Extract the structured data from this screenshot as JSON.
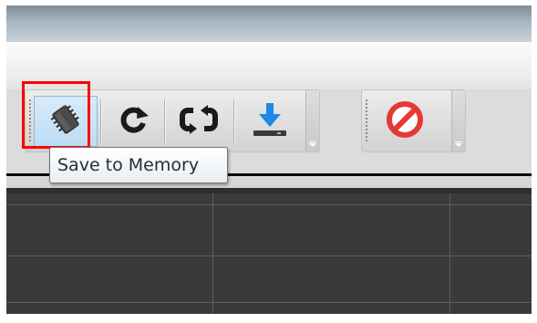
{
  "toolbar": {
    "buttons": [
      {
        "name": "save-to-memory",
        "icon": "memory-chip-icon"
      },
      {
        "name": "refresh",
        "icon": "refresh-icon"
      },
      {
        "name": "sync",
        "icon": "sync-icon"
      },
      {
        "name": "download",
        "icon": "download-icon"
      }
    ],
    "stop_button": {
      "icon": "stop-icon"
    }
  },
  "tooltip": {
    "text": "Save to Memory"
  },
  "colors": {
    "highlight": "#ff0000",
    "download_blue": "#1e88e5",
    "stop_red": "#e53935"
  }
}
